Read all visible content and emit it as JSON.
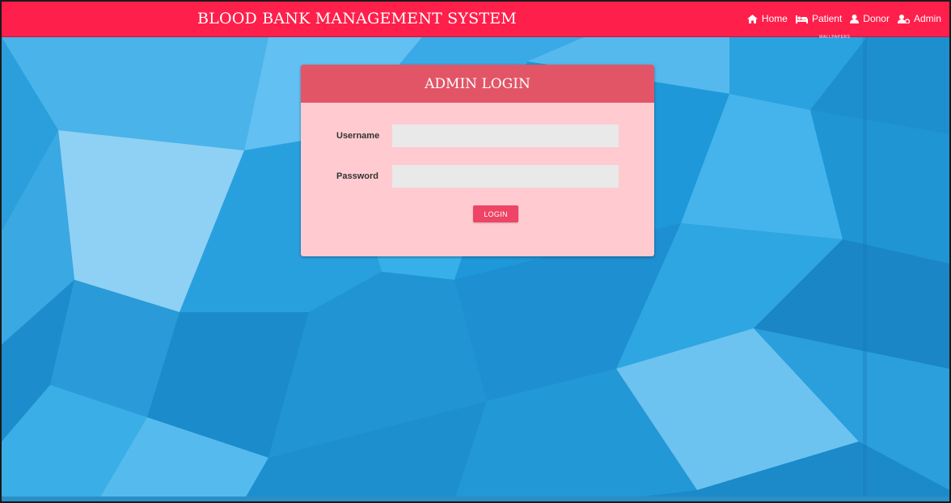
{
  "navbar": {
    "brand": "BLOOD BANK MANAGEMENT SYSTEM",
    "items": [
      {
        "label": "Home",
        "icon": "home-icon"
      },
      {
        "label": "Patient",
        "icon": "bed-icon"
      },
      {
        "label": "Donor",
        "icon": "user-icon"
      },
      {
        "label": "Admin",
        "icon": "user-cog-icon"
      }
    ],
    "watermark": "WALLPAPERS"
  },
  "login": {
    "title": "ADMIN LOGIN",
    "username_label": "Username",
    "username_value": "",
    "password_label": "Password",
    "password_value": "",
    "button_label": "LOGIN"
  },
  "colors": {
    "navbar": "#ff1f4b",
    "card_header": "#e25567",
    "card_body": "#ffcbd0",
    "button": "#ee4466",
    "background": "#1f9bd8"
  }
}
